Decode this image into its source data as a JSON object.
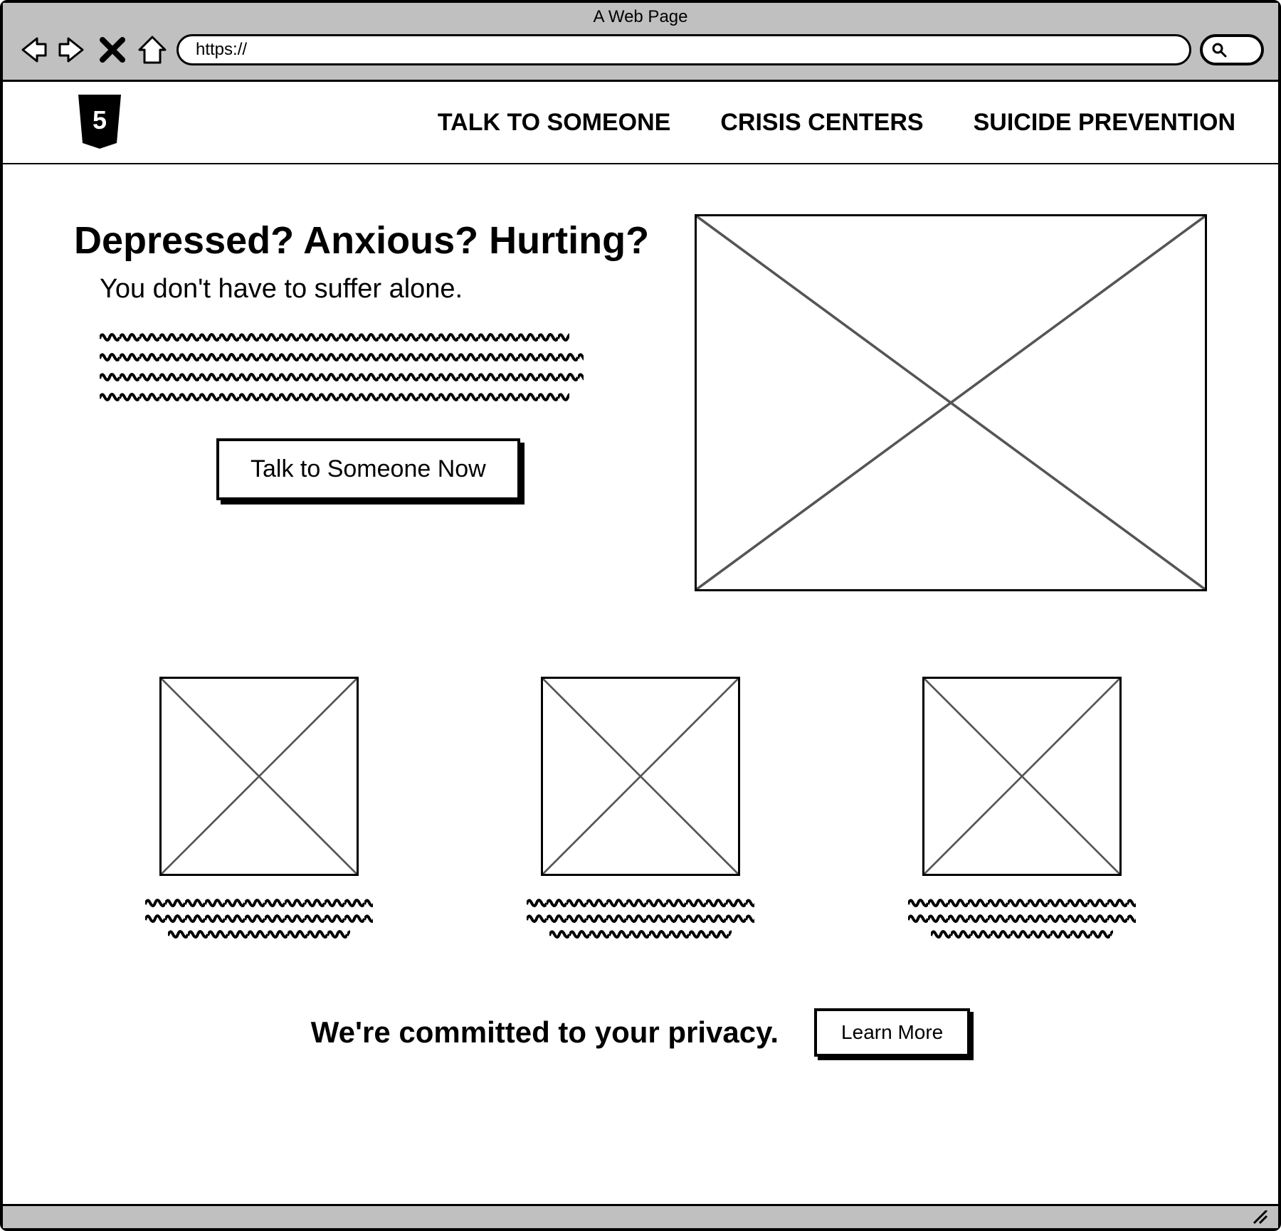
{
  "browser": {
    "title": "A Web Page",
    "url": "https://"
  },
  "nav": {
    "items": [
      {
        "label": "TALK TO SOMEONE"
      },
      {
        "label": "CRISIS CENTERS"
      },
      {
        "label": "SUICIDE PREVENTION"
      }
    ]
  },
  "hero": {
    "title": "Depressed? Anxious? Hurting?",
    "subtitle": "You don't have to suffer alone.",
    "cta_label": "Talk to Someone Now"
  },
  "privacy": {
    "text": "We're committed to your privacy.",
    "button_label": "Learn More"
  }
}
